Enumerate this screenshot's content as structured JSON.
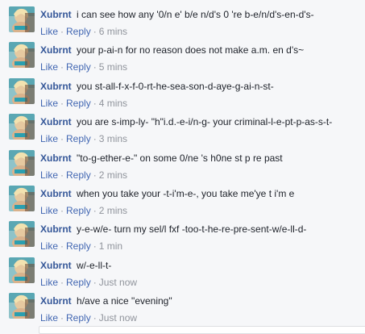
{
  "comments": [
    {
      "author": "Xubrnt",
      "text": "i can see how any '0/n e' b/e n/d's 0 're b-e/n/d's-en-d's-",
      "like": "Like",
      "reply": "Reply",
      "time": "6 mins"
    },
    {
      "author": "Xubrnt",
      "text": "your p-ai-n for no reason does not make a.m. en d's~",
      "like": "Like",
      "reply": "Reply",
      "time": "5 mins"
    },
    {
      "author": "Xubrnt",
      "text": "you st-all-f-x-f-0-rt-he-sea-son-d-aye-g-ai-n-st-",
      "like": "Like",
      "reply": "Reply",
      "time": "4 mins"
    },
    {
      "author": "Xubrnt",
      "text": "you are s-imp-ly- \"h\"i.d.-e-i/n-g- your criminal-l-e-pt-p-as-s-t-",
      "like": "Like",
      "reply": "Reply",
      "time": "3 mins"
    },
    {
      "author": "Xubrnt",
      "text": "\"to-g-ether-e-\" on some 0/ne 's h0ne st p re past",
      "like": "Like",
      "reply": "Reply",
      "time": "2 mins"
    },
    {
      "author": "Xubrnt",
      "text": "when you take your -t-i'm-e-, you take me'ye t i'm e",
      "like": "Like",
      "reply": "Reply",
      "time": "2 mins"
    },
    {
      "author": "Xubrnt",
      "text": "y-e-w/e- turn my sel/l fxf -too-t-he-re-pre-sent-w/e-ll-d-",
      "like": "Like",
      "reply": "Reply",
      "time": "1 min"
    },
    {
      "author": "Xubrnt",
      "text": "w/-e-ll-t-",
      "like": "Like",
      "reply": "Reply",
      "time": "Just now"
    },
    {
      "author": "Xubrnt",
      "text": "h/ave a nice \"evening\"",
      "like": "Like",
      "reply": "Reply",
      "time": "Just now"
    }
  ],
  "colors": {
    "author": "#365899",
    "action": "#4267b2",
    "meta": "#90949c",
    "text": "#1d2129"
  }
}
